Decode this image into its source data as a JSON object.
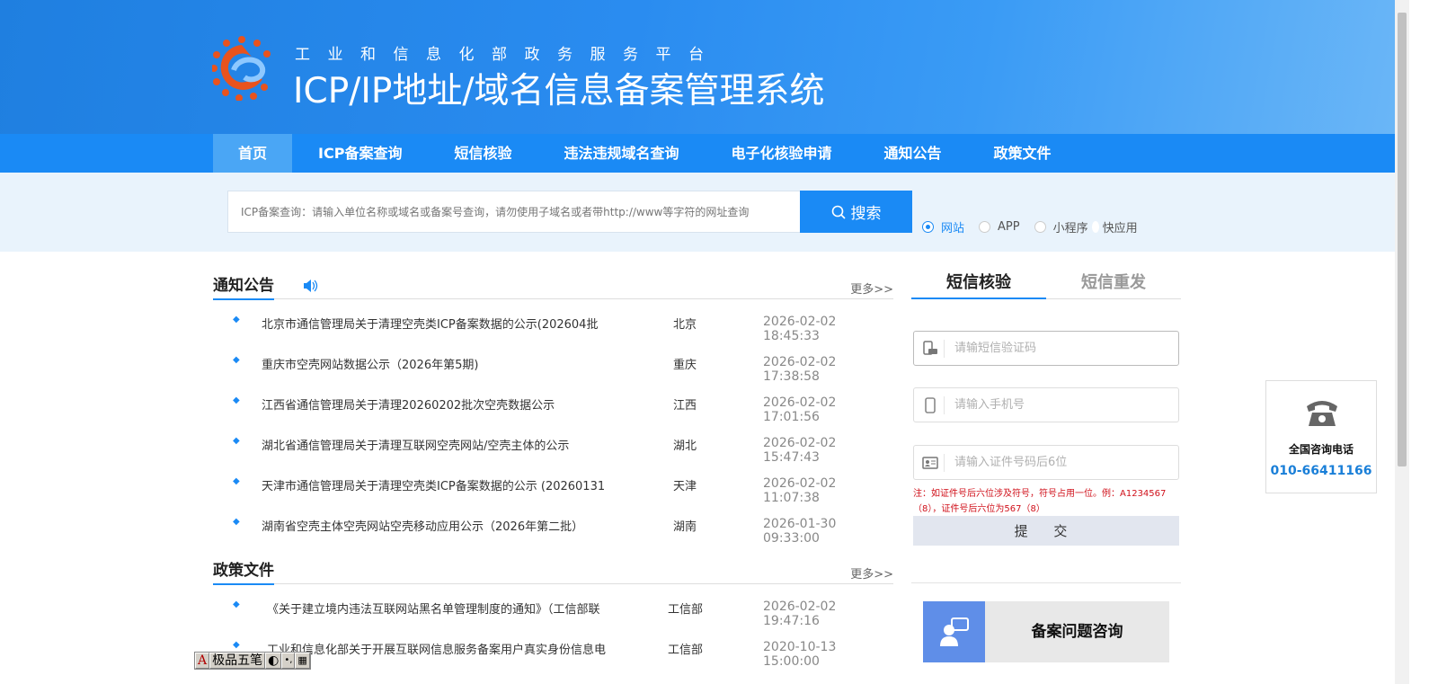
{
  "header": {
    "subtitle": "工业和信息化部政务服务平台",
    "title": "ICP/IP地址/域名信息备案管理系统"
  },
  "nav": {
    "items": [
      {
        "label": "首页",
        "active": true
      },
      {
        "label": "ICP备案查询"
      },
      {
        "label": "短信核验"
      },
      {
        "label": "违法违规域名查询"
      },
      {
        "label": "电子化核验申请"
      },
      {
        "label": "通知公告"
      },
      {
        "label": "政策文件"
      }
    ]
  },
  "search": {
    "placeholder": "ICP备案查询：请输入单位名称或域名或备案号查询，请勿使用子域名或者带http://www等字符的网址查询",
    "button": "搜索",
    "options": [
      {
        "label": "网站",
        "selected": true
      },
      {
        "label": "APP"
      },
      {
        "label": "小程序"
      },
      {
        "label": "快应用"
      }
    ]
  },
  "notices": {
    "title": "通知公告",
    "more": "更多>>",
    "items": [
      {
        "title": "北京市通信管理局关于清理空壳类ICP备案数据的公示(202604批",
        "region": "北京",
        "date": "2026-02-02 18:45:33"
      },
      {
        "title": "重庆市空壳网站数据公示（2026年第5期)",
        "region": "重庆",
        "date": "2026-02-02 17:38:58"
      },
      {
        "title": "江西省通信管理局关于清理20260202批次空壳数据公示",
        "region": "江西",
        "date": "2026-02-02 17:01:56"
      },
      {
        "title": "湖北省通信管理局关于清理互联网空壳网站/空壳主体的公示",
        "region": "湖北",
        "date": "2026-02-02 15:47:43"
      },
      {
        "title": "天津市通信管理局关于清理空壳类ICP备案数据的公示 (20260131",
        "region": "天津",
        "date": "2026-02-02 11:07:38"
      },
      {
        "title": "湖南省空壳主体空壳网站空壳移动应用公示（2026年第二批）",
        "region": "湖南",
        "date": "2026-01-30 09:33:00"
      }
    ]
  },
  "policies": {
    "title": "政策文件",
    "more": "更多>>",
    "items": [
      {
        "title": "《关于建立境内违法互联网站黑名单管理制度的通知》（工信部联",
        "region": "工信部",
        "date": "2026-02-02 19:47:16"
      },
      {
        "title": "工业和信息化部关于开展互联网信息服务备案用户真实身份信息电",
        "region": "工信部",
        "date": "2020-10-13 15:00:00"
      }
    ]
  },
  "sms": {
    "tabs": [
      "短信核验",
      "短信重发"
    ],
    "code_placeholder": "请输短信验证码",
    "phone_placeholder": "请输入手机号",
    "id_placeholder": "请输入证件号码后6位",
    "note": "注：如证件号后六位涉及符号，符号占用一位。例：A1234567（8），证件号后六位为567（8）",
    "submit": "提 交"
  },
  "consult": {
    "label": "备案问题咨询"
  },
  "hotline": {
    "label": "全国咨询电话",
    "number": "010-66411166"
  },
  "ime": {
    "mode": "A",
    "name": "极品五笔"
  },
  "colors": {
    "primary": "#1a8af5",
    "note": "#d0111b",
    "consult_icon_bg": "#5f8ee8"
  }
}
